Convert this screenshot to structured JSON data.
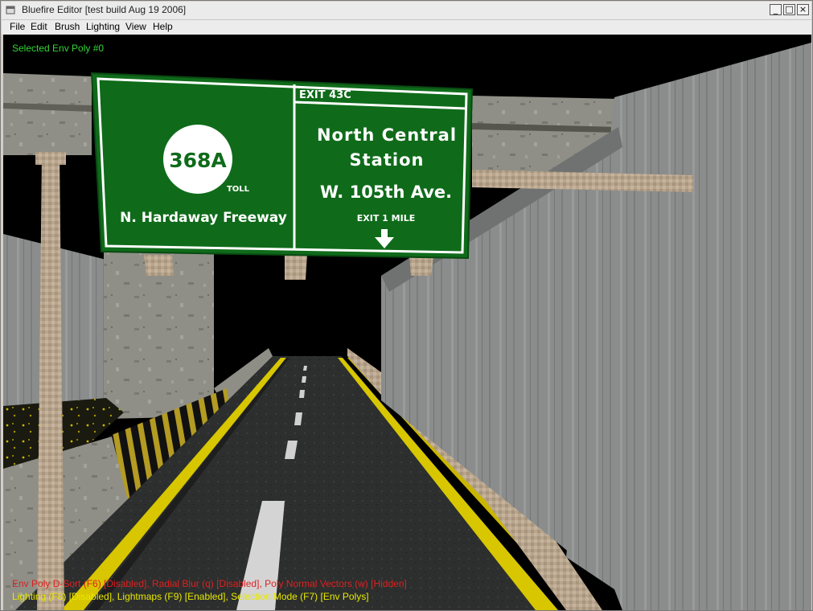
{
  "window": {
    "title": "Bluefire Editor [test build Aug 19 2006]",
    "controls": {
      "minimize": "_",
      "maximize": "□",
      "close": "×"
    }
  },
  "menu": [
    "File",
    "Edit",
    "Brush",
    "Lighting",
    "View",
    "Help"
  ],
  "overlay": {
    "selection": "Selected Env Poly #0",
    "status_line_1": "Env Poly D-Sort (F6) [Disabled], Radial Blur (q) [Disabled], Poly Normal Vectors (w) [Hidden]",
    "status_line_2": "Lighting (F8) [Disabled], Lightmaps (F9) [Enabled], Selection Mode (F7) [Env Polys]"
  },
  "sign": {
    "route_shield": "368A",
    "toll": "TOLL",
    "left_destination": "N. Hardaway Freeway",
    "exit_tab": "EXIT 43C",
    "right_line_1": "North Central",
    "right_line_2": "Station",
    "right_line_3": "W. 105th Ave.",
    "exit_distance": "EXIT 1 MILE"
  },
  "colors": {
    "sign_green": "#0f6b1a",
    "selection_text": "#33d633",
    "status_red": "#e02020",
    "status_yellow": "#e8e800",
    "road_asphalt": "#2a2d2c",
    "lane_yellow": "#d8c600",
    "concrete": "#8c8c84"
  }
}
